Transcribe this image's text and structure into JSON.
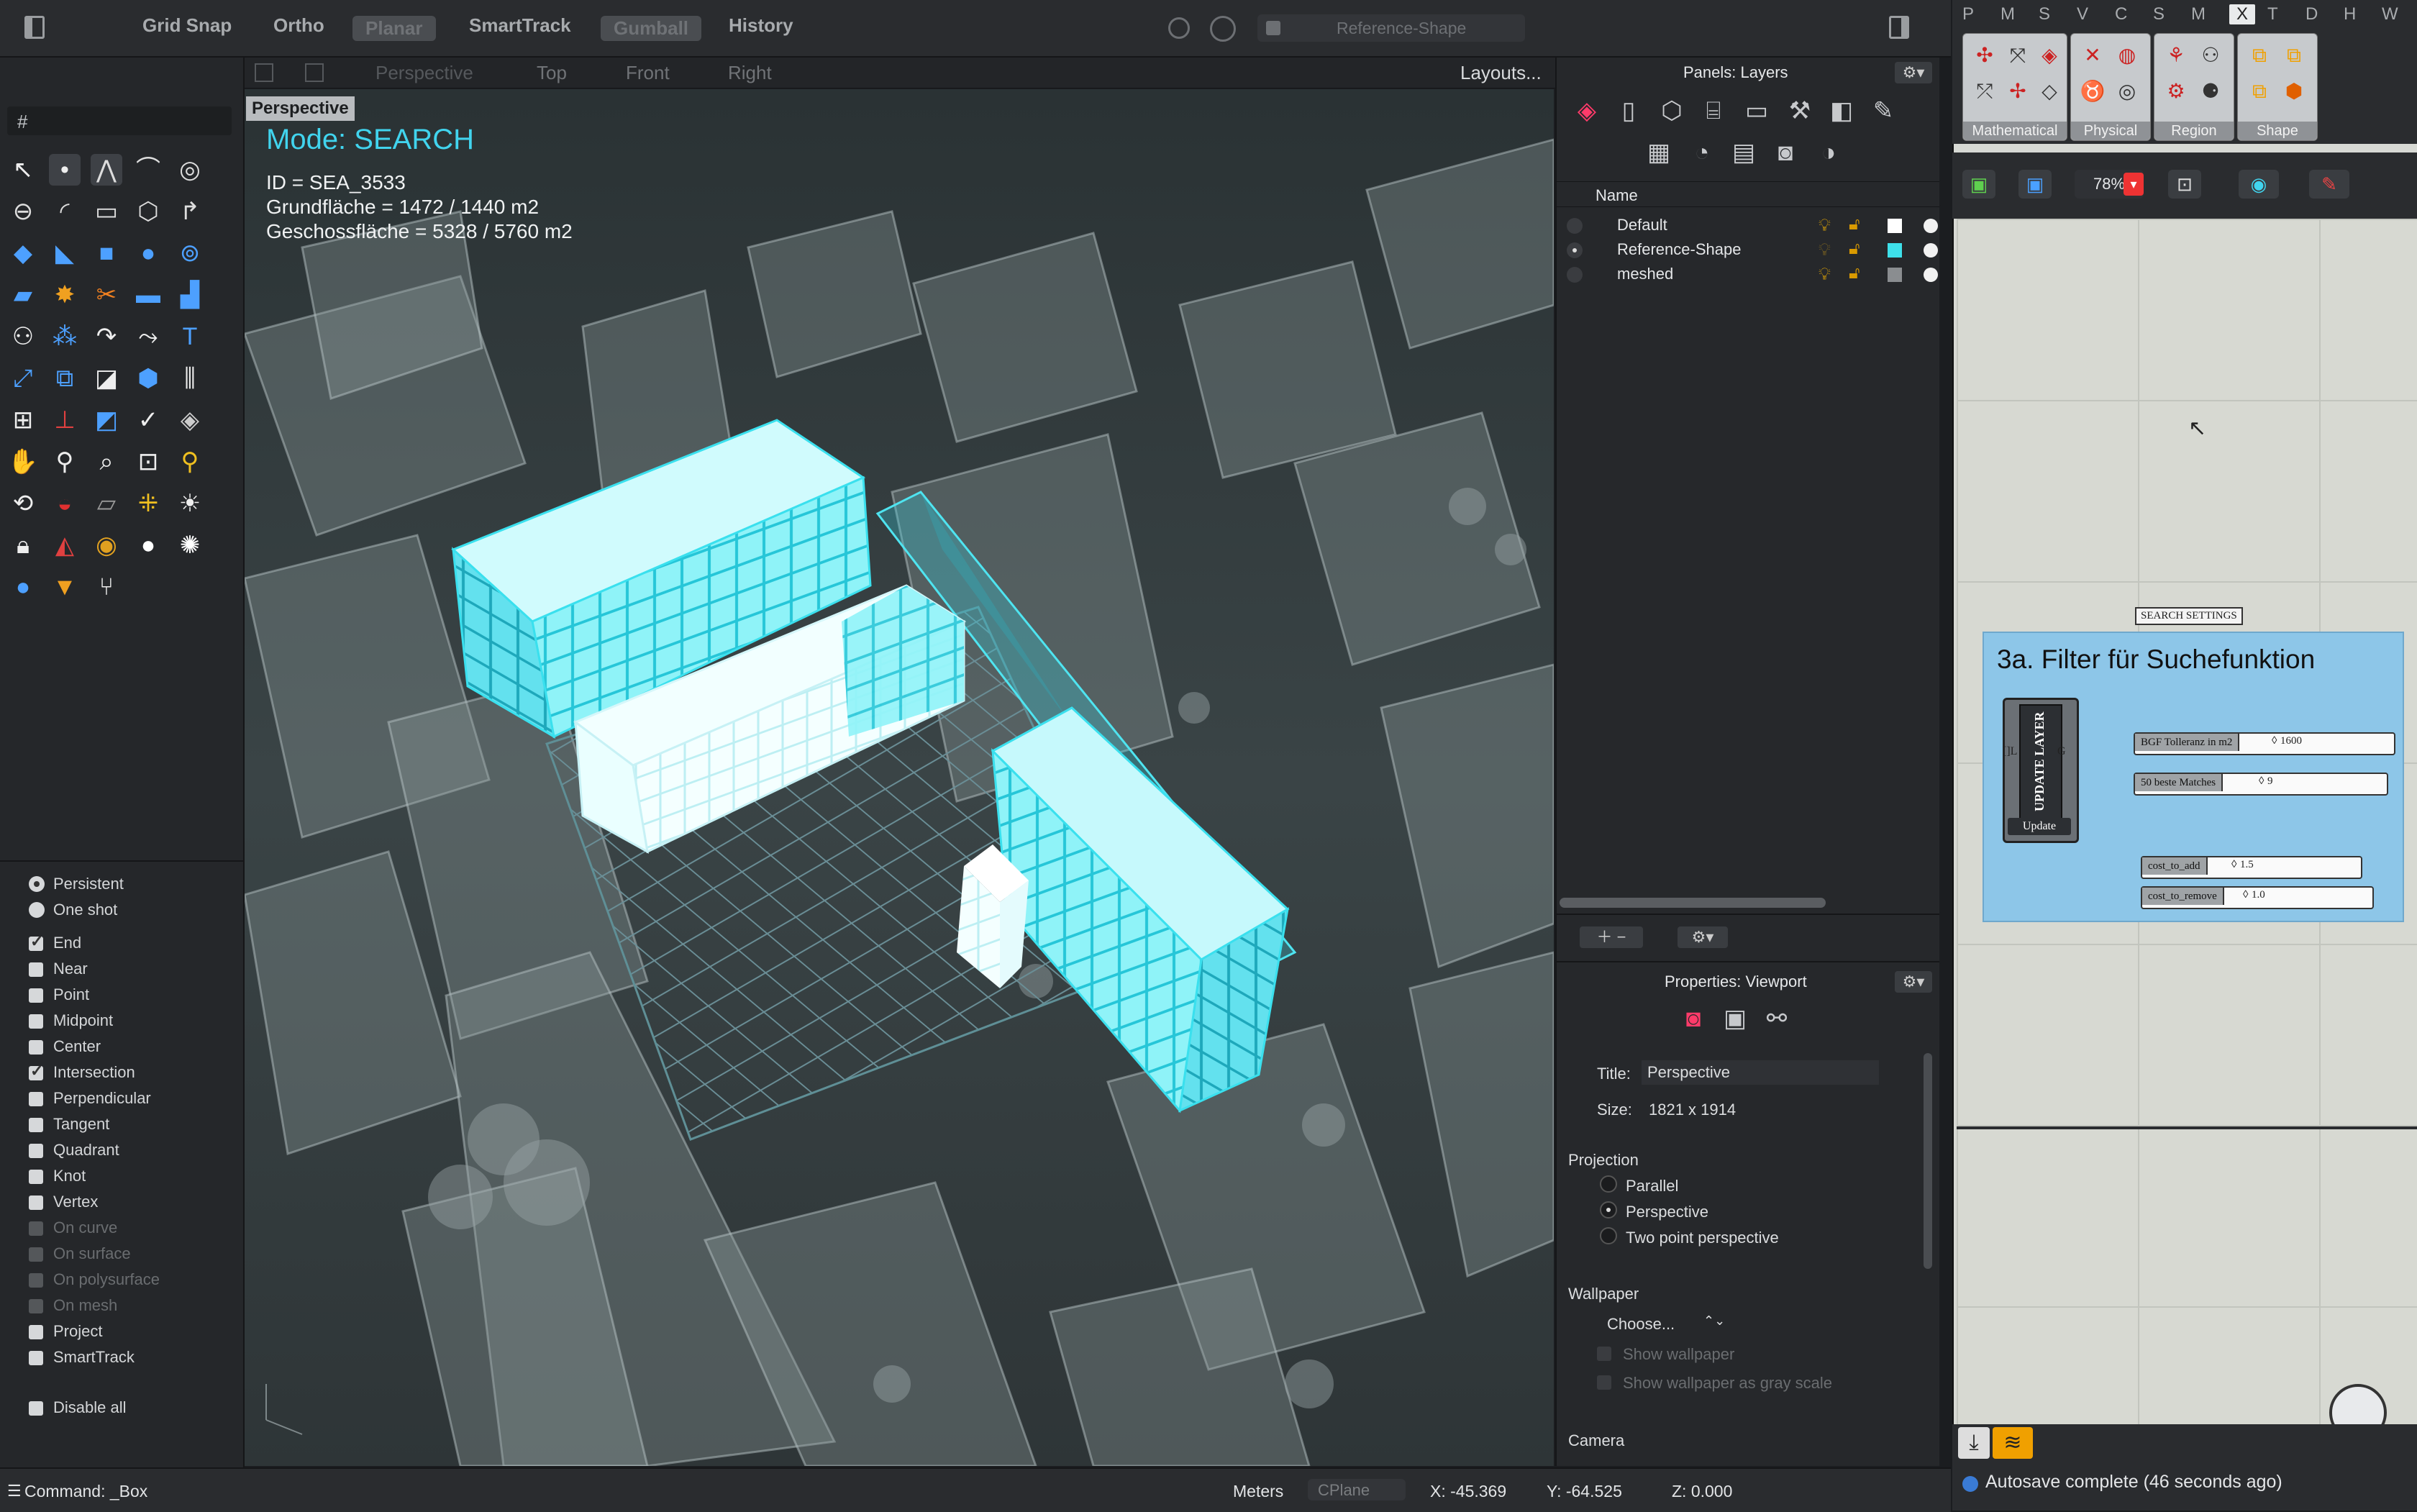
{
  "toolbar": {
    "items": [
      "Grid Snap",
      "Ortho",
      "Planar",
      "SmartTrack",
      "Gumball",
      "History"
    ],
    "layer_selector": "Reference-Shape"
  },
  "command_field": "#",
  "viewport": {
    "tabs": [
      "Perspective",
      "Top",
      "Front",
      "Right"
    ],
    "layouts": "Layouts...",
    "label": "Perspective",
    "mode": "Mode: SEARCH",
    "id": "ID = SEA_3533",
    "grundflaeche": "Grundfläche = 1472 / 1440 m2",
    "geschossflaeche": "Geschossfläche = 5328 / 5760 m2"
  },
  "osnap": {
    "modes": [
      {
        "label": "Persistent",
        "type": "radio",
        "on": true
      },
      {
        "label": "One shot",
        "type": "radio",
        "on": false
      }
    ],
    "items": [
      {
        "label": "End",
        "on": true,
        "dim": false
      },
      {
        "label": "Near",
        "on": false,
        "dim": false
      },
      {
        "label": "Point",
        "on": false,
        "dim": false
      },
      {
        "label": "Midpoint",
        "on": false,
        "dim": false
      },
      {
        "label": "Center",
        "on": false,
        "dim": false
      },
      {
        "label": "Intersection",
        "on": true,
        "dim": false
      },
      {
        "label": "Perpendicular",
        "on": false,
        "dim": false
      },
      {
        "label": "Tangent",
        "on": false,
        "dim": false
      },
      {
        "label": "Quadrant",
        "on": false,
        "dim": false
      },
      {
        "label": "Knot",
        "on": false,
        "dim": false
      },
      {
        "label": "Vertex",
        "on": false,
        "dim": false
      },
      {
        "label": "On curve",
        "on": false,
        "dim": true
      },
      {
        "label": "On surface",
        "on": false,
        "dim": true
      },
      {
        "label": "On polysurface",
        "on": false,
        "dim": true
      },
      {
        "label": "On mesh",
        "on": false,
        "dim": true
      },
      {
        "label": "Project",
        "on": false,
        "dim": false
      },
      {
        "label": "SmartTrack",
        "on": false,
        "dim": false
      }
    ],
    "disable_all": "Disable all"
  },
  "layers_panel": {
    "title": "Panels: Layers",
    "column": "Name",
    "layers": [
      {
        "name": "Default",
        "color": "#ffffff",
        "current": false
      },
      {
        "name": "Reference-Shape",
        "color": "#3ee0ea",
        "current": true
      },
      {
        "name": "meshed",
        "color": "#8a8d90",
        "current": false
      }
    ]
  },
  "properties": {
    "title": "Properties: Viewport",
    "title_label": "Title:",
    "title_value": "Perspective",
    "size_label": "Size:",
    "size_value": "1821 x 1914",
    "projection_label": "Projection",
    "projection_options": [
      "Parallel",
      "Perspective",
      "Two point perspective"
    ],
    "projection_selected": "Perspective",
    "wallpaper_label": "Wallpaper",
    "choose": "Choose...",
    "show_wallpaper": "Show wallpaper",
    "show_wallpaper_gray": "Show wallpaper as gray scale",
    "camera_label": "Camera"
  },
  "grasshopper": {
    "tabs": [
      "P",
      "M",
      "S",
      "V",
      "C",
      "S",
      "M",
      "X",
      "T",
      "D",
      "H",
      "W"
    ],
    "selected_tab": "X",
    "groups": [
      "Mathematical",
      "Physical",
      "Region",
      "Shape"
    ],
    "zoom": "78%",
    "group_tag": "SEARCH SETTINGS",
    "group_title": "3a. Filter für Suchefunktion",
    "update_layer": "UPDATE LAYER",
    "update_button": "Update",
    "update_in": "[]L",
    "update_out": "G",
    "sliders": [
      {
        "label": "BGF Tolleranz in m2",
        "value": "1600"
      },
      {
        "label": "50 beste Matches",
        "value": "9"
      },
      {
        "label": "cost_to_add",
        "value": "1.5"
      },
      {
        "label": "cost_to_remove",
        "value": "1.0"
      }
    ],
    "autosave": "Autosave complete (46 seconds ago)"
  },
  "status": {
    "command": "Command: _Box",
    "units": "Meters",
    "cplane": "CPlane",
    "x": "X: -45.369",
    "y": "Y: -64.525",
    "z": "Z: 0.000"
  },
  "colors": {
    "accent_cyan": "#3ee0ea",
    "mode_text": "#41d4ee",
    "gh_group": "#8dc6e8"
  }
}
